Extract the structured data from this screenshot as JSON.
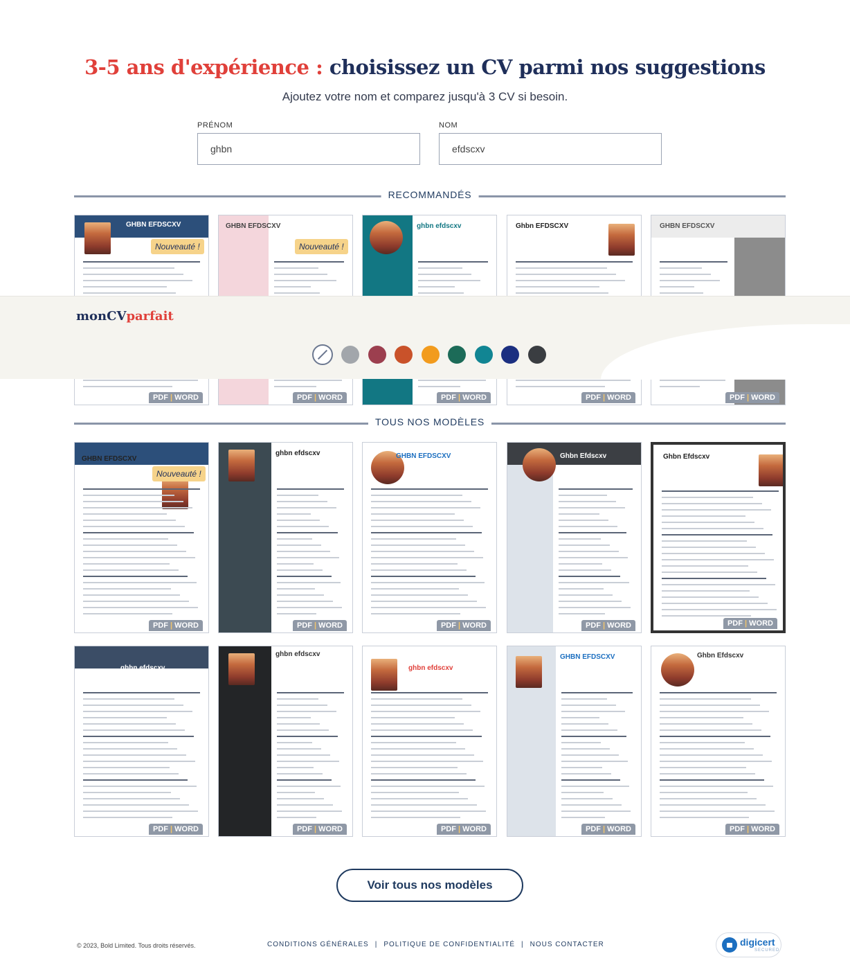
{
  "hero": {
    "title_accent": "3-5 ans d'expérience :",
    "title_main": "choisissez un CV parmi nos suggestions",
    "subtitle": "Ajoutez votre nom et comparez jusqu'à 3 CV si besoin."
  },
  "form": {
    "first_name_label": "PRÉNOM",
    "first_name_value": "ghbn",
    "last_name_label": "NOM",
    "last_name_value": "efdscxv"
  },
  "sections": {
    "recommended": "RECOMMANDÉS",
    "all_models": "TOUS NOS MODÈLES"
  },
  "card_labels": {
    "pdf": "PDF",
    "separator": "|",
    "word": "WORD",
    "new_badge": "Nouveauté !"
  },
  "recommended_cards": [
    {
      "name": "GHBN EFDSCXV",
      "badge": true
    },
    {
      "name": "GHBN EFDSCXV",
      "badge": true
    },
    {
      "name": "ghbn efdscxv",
      "badge": false
    },
    {
      "name": "Ghbn EFDSCXV",
      "badge": false
    },
    {
      "name": "GHBN EFDSCXV",
      "badge": false
    }
  ],
  "all_cards": [
    {
      "name": "GHBN EFDSCXV",
      "badge": true
    },
    {
      "name": "ghbn efdscxv",
      "badge": false
    },
    {
      "name": "GHBN EFDSCXV",
      "badge": false
    },
    {
      "name": "Ghbn Efdscxv",
      "badge": false
    },
    {
      "name": "Ghbn Efdscxv",
      "badge": false
    },
    {
      "name": "ghbn efdscxv",
      "badge": false
    },
    {
      "name": "ghbn efdscxv",
      "badge": false
    },
    {
      "name": "ghbn efdscxv",
      "badge": false
    },
    {
      "name": "GHBN EFDSCXV",
      "badge": false
    },
    {
      "name": "Ghbn Efdscxv",
      "badge": false
    }
  ],
  "overlay": {
    "logo_main": "monCV",
    "logo_accent": "parfait",
    "colors": [
      "#a2a6ab",
      "#9c3f4f",
      "#c9522a",
      "#f29b1d",
      "#1c6b58",
      "#118593",
      "#1b2f80",
      "#3a3d41"
    ]
  },
  "cta": {
    "label": "Voir tous nos modèles"
  },
  "footer": {
    "copyright": "© 2023, Bold Limited. Tous droits réservés.",
    "links": [
      "CONDITIONS GÉNÉRALES",
      "POLITIQUE DE CONFIDENTIALITÉ",
      "NOUS CONTACTER"
    ],
    "seal_text": "digicert",
    "seal_sub": "SECURED"
  }
}
